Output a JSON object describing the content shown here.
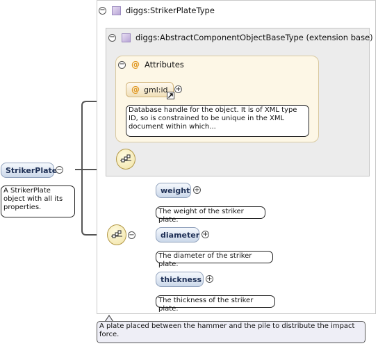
{
  "type_header": {
    "label": "diggs:StrikerPlateType"
  },
  "extension_header": {
    "label": "diggs:AbstractComponentObjectBaseType (extension base)"
  },
  "attributes": {
    "header": "Attributes",
    "items": [
      {
        "name": "gml:id",
        "doc": "Database handle for the object. It is of XML type ID, so is constrained to be unique in the XML document within which..."
      }
    ]
  },
  "root": {
    "name": "StrikerPlate",
    "doc": "A StrikerPlate object with all its properties."
  },
  "elements": [
    {
      "name": "weight",
      "doc": "The weight of the striker plate."
    },
    {
      "name": "diameter",
      "doc": "The diameter of the striker plate."
    },
    {
      "name": "thickness",
      "doc": "The thickness of the striker plate."
    }
  ],
  "type_doc": "A plate placed between the hammer and the pile to distribute the impact force.",
  "icons": {
    "collapse": "collapse-minus-icon",
    "expand": "expand-plus-icon",
    "complex_type": "complex-type-icon",
    "attribute": "attribute-at-icon",
    "sequence": "sequence-compositor-icon",
    "reference": "reference-arrow-icon"
  },
  "colors": {
    "element_fill": "#cbd8ea",
    "element_border": "#8fa0bb",
    "attribute_fill": "#f0dfb8",
    "attributes_bg": "#fdf7e6",
    "extension_bg": "#ececec",
    "type_doc_bg": "#eeeef6"
  }
}
